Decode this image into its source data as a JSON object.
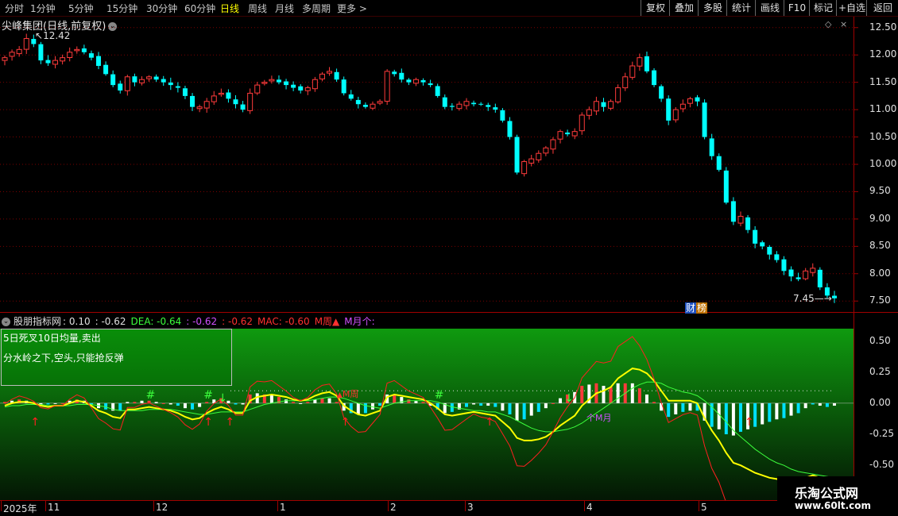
{
  "toolbar": {
    "timeframes": [
      "分时",
      "1分钟",
      "5分钟",
      "15分钟",
      "30分钟",
      "60分钟",
      "日线",
      "周线",
      "月线",
      "多周期",
      "更多 >"
    ],
    "active_index": 6,
    "right_buttons": [
      "复权",
      "叠加",
      "多股",
      "统计",
      "画线",
      "F10",
      "标记",
      "+自选",
      "返回"
    ]
  },
  "stock": {
    "title": "尖峰集团(日线,前复权)",
    "high_label": "12.42",
    "low_label": "7.45",
    "badges": [
      "财",
      "榜"
    ]
  },
  "price_axis": {
    "labels": [
      "12.50",
      "12.00",
      "11.50",
      "11.00",
      "10.50",
      "10.00",
      "9.50",
      "9.00",
      "8.50",
      "8.00",
      "7.50"
    ]
  },
  "indicator": {
    "name": "股朋指标网",
    "v1": ": 0.10",
    "v2": ": -0.62",
    "dea": "DEA: -0.64",
    "v3": ": -0.62",
    "v4": ": -0.62",
    "mac": "MAC: -0.60",
    "week_tag": "M周▲",
    "month_tag": "M月个:",
    "axis_labels": [
      "0.50",
      "0.25",
      "0.00",
      "-0.25",
      "-0.50"
    ],
    "annotations": {
      "week": "M周",
      "month": "个M月"
    }
  },
  "overlay": {
    "line1": "5日死叉10日均量,卖出",
    "line2": "分水岭之下,空头,只能抢反弹"
  },
  "date_axis": {
    "labels": [
      "2025年",
      "11",
      "12",
      "1",
      "2",
      "3",
      "4",
      "5"
    ]
  },
  "watermark": {
    "line1": "乐淘公式网",
    "line2": "www.60lt.com"
  },
  "chart_data": [
    {
      "type": "candlestick",
      "title": "尖峰集团(日线,前复权)",
      "ylim": [
        7.3,
        12.7
      ],
      "closes": [
        11.95,
        12.05,
        12.1,
        12.3,
        12.2,
        11.9,
        11.85,
        11.9,
        11.95,
        12.05,
        12.1,
        12.05,
        11.95,
        11.8,
        11.65,
        11.45,
        11.35,
        11.6,
        11.5,
        11.55,
        11.6,
        11.55,
        11.5,
        11.45,
        11.4,
        11.25,
        11.05,
        11.05,
        11.15,
        11.25,
        11.3,
        11.2,
        11.1,
        11.0,
        11.3,
        11.45,
        11.5,
        11.55,
        11.5,
        11.45,
        11.4,
        11.35,
        11.4,
        11.55,
        11.65,
        11.7,
        11.55,
        11.3,
        11.2,
        11.1,
        11.05,
        11.1,
        11.15,
        11.7,
        11.65,
        11.55,
        11.5,
        11.55,
        11.5,
        11.45,
        11.25,
        11.05,
        11.05,
        11.1,
        11.15,
        11.1,
        11.1,
        11.05,
        11.0,
        10.8,
        10.5,
        9.85,
        10.05,
        10.1,
        10.2,
        10.3,
        10.45,
        10.6,
        10.55,
        10.6,
        10.9,
        11.0,
        11.15,
        11.05,
        11.15,
        11.4,
        11.6,
        11.8,
        11.95,
        11.7,
        11.45,
        11.2,
        10.8,
        11.0,
        11.1,
        11.2,
        11.15,
        10.5,
        10.15,
        9.9,
        9.3,
        8.95,
        9.05,
        8.8,
        8.55,
        8.5,
        8.35,
        8.25,
        8.05,
        7.95,
        7.9,
        8.05,
        8.1,
        7.75,
        7.6,
        7.55
      ],
      "last_close": 7.55
    },
    {
      "type": "line",
      "title": "股朋指标网",
      "ylim": [
        -0.78,
        0.6
      ],
      "dif": [
        -0.02,
        0.0,
        0.01,
        0.01,
        0.0,
        -0.02,
        -0.03,
        -0.02,
        -0.02,
        0.0,
        0.02,
        0.01,
        -0.02,
        -0.06,
        -0.08,
        -0.11,
        -0.12,
        -0.05,
        -0.05,
        -0.04,
        -0.03,
        -0.04,
        -0.05,
        -0.06,
        -0.08,
        -0.11,
        -0.13,
        -0.12,
        -0.08,
        -0.05,
        -0.03,
        -0.05,
        -0.08,
        -0.08,
        0.02,
        0.05,
        0.06,
        0.07,
        0.06,
        0.05,
        0.03,
        0.02,
        0.03,
        0.06,
        0.08,
        0.09,
        0.06,
        -0.02,
        -0.06,
        -0.09,
        -0.1,
        -0.08,
        -0.06,
        0.05,
        0.07,
        0.06,
        0.05,
        0.04,
        0.03,
        0.0,
        -0.04,
        -0.09,
        -0.1,
        -0.09,
        -0.08,
        -0.07,
        -0.08,
        -0.09,
        -0.1,
        -0.15,
        -0.2,
        -0.28,
        -0.3,
        -0.3,
        -0.29,
        -0.27,
        -0.23,
        -0.18,
        -0.14,
        -0.1,
        -0.02,
        0.03,
        0.08,
        0.1,
        0.13,
        0.2,
        0.24,
        0.28,
        0.27,
        0.24,
        0.18,
        0.1,
        0.02,
        0.02,
        0.02,
        0.02,
        0.0,
        -0.12,
        -0.22,
        -0.3,
        -0.4,
        -0.48,
        -0.5,
        -0.53,
        -0.56,
        -0.58,
        -0.6,
        -0.61,
        -0.62,
        -0.63,
        -0.63,
        -0.6,
        -0.58,
        -0.6,
        -0.62,
        -0.62
      ],
      "dea": [
        -0.03,
        -0.02,
        -0.02,
        -0.01,
        -0.01,
        -0.01,
        -0.02,
        -0.02,
        -0.02,
        -0.02,
        -0.01,
        -0.01,
        -0.01,
        -0.02,
        -0.03,
        -0.05,
        -0.06,
        -0.06,
        -0.06,
        -0.06,
        -0.05,
        -0.05,
        -0.05,
        -0.05,
        -0.06,
        -0.07,
        -0.08,
        -0.09,
        -0.09,
        -0.08,
        -0.07,
        -0.07,
        -0.07,
        -0.07,
        -0.05,
        -0.03,
        -0.01,
        0.0,
        0.01,
        0.02,
        0.02,
        0.02,
        0.02,
        0.03,
        0.04,
        0.05,
        0.05,
        0.04,
        0.02,
        0.0,
        -0.02,
        -0.03,
        -0.04,
        -0.02,
        0.0,
        0.01,
        0.02,
        0.02,
        0.02,
        0.02,
        0.01,
        -0.01,
        -0.03,
        -0.04,
        -0.05,
        -0.06,
        -0.06,
        -0.07,
        -0.07,
        -0.09,
        -0.11,
        -0.14,
        -0.17,
        -0.2,
        -0.22,
        -0.23,
        -0.23,
        -0.22,
        -0.21,
        -0.19,
        -0.16,
        -0.12,
        -0.08,
        -0.04,
        0.0,
        0.04,
        0.08,
        0.12,
        0.15,
        0.17,
        0.17,
        0.16,
        0.13,
        0.11,
        0.09,
        0.08,
        0.06,
        0.02,
        -0.03,
        -0.09,
        -0.15,
        -0.22,
        -0.27,
        -0.32,
        -0.37,
        -0.41,
        -0.45,
        -0.48,
        -0.5,
        -0.53,
        -0.55,
        -0.56,
        -0.57,
        -0.58,
        -0.59,
        -0.6
      ]
    }
  ]
}
